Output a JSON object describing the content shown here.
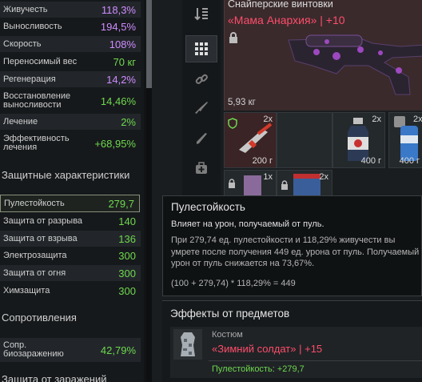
{
  "stats": [
    {
      "label": "Живучесть",
      "value": "118,3%",
      "color": "purple"
    },
    {
      "label": "Выносливость",
      "value": "194,5%",
      "color": "purple"
    },
    {
      "label": "Скорость",
      "value": "108%",
      "color": "purple"
    },
    {
      "label": "Переносимый вес",
      "value": "70 кг",
      "color": "green"
    },
    {
      "label": "Регенерация",
      "value": "14,2%",
      "color": "purple"
    },
    {
      "label": "Восстановление выносливости",
      "value": "14,46%",
      "color": "green"
    },
    {
      "label": "Лечение",
      "value": "2%",
      "color": "green"
    },
    {
      "label": "Эффективность лечения",
      "value": "+68,95%",
      "color": "green"
    }
  ],
  "protection_title": "Защитные характеристики",
  "protection": [
    {
      "label": "Пулестойкость",
      "value": "279,7"
    },
    {
      "label": "Защита от разрыва",
      "value": "140"
    },
    {
      "label": "Защита от взрыва",
      "value": "136"
    },
    {
      "label": "Электрозащита",
      "value": "300"
    },
    {
      "label": "Защита от огня",
      "value": "300"
    },
    {
      "label": "Химзащита",
      "value": "300"
    }
  ],
  "resist_title": "Сопротивления",
  "resist": [
    {
      "label": "Сопр. биозаражению",
      "value": "42,79%"
    }
  ],
  "infection_title": "Защита от заражений",
  "weapon": {
    "category": "Снайперские винтовки",
    "name": "«Мама Анархия»",
    "upgrade": "+10",
    "weight": "5,93 кг"
  },
  "slots": [
    {
      "count": "2x",
      "weight": "200 г"
    },
    {
      "count": "2x",
      "weight": "400 г"
    },
    {
      "count": "2x",
      "weight": "400 г"
    },
    {
      "count": "1x",
      "weight": ""
    },
    {
      "count": "2x",
      "weight": ""
    }
  ],
  "tooltip": {
    "title": "Пулестойкость",
    "subtitle": "Влияет на урон, получаемый от пуль.",
    "body": "При 279,74 ед. пулестойкости и 118,29% живучести вы умрете после получения 449 ед. урона от пуль. Получаемый урон от пуль снижается на 73,67%.",
    "formula": "(100 + 279,74) * 118,29% = 449"
  },
  "effects": {
    "title": "Эффекты от предметов",
    "item_type": "Костюм",
    "item_name": "«Зимний солдат»",
    "item_upgrade": "+15",
    "bonus": "Пулестойкость: +279,7"
  },
  "colors": {
    "purple": "#d08cff",
    "green": "#6fd84f",
    "rarity_red": "#ff4d6a"
  }
}
